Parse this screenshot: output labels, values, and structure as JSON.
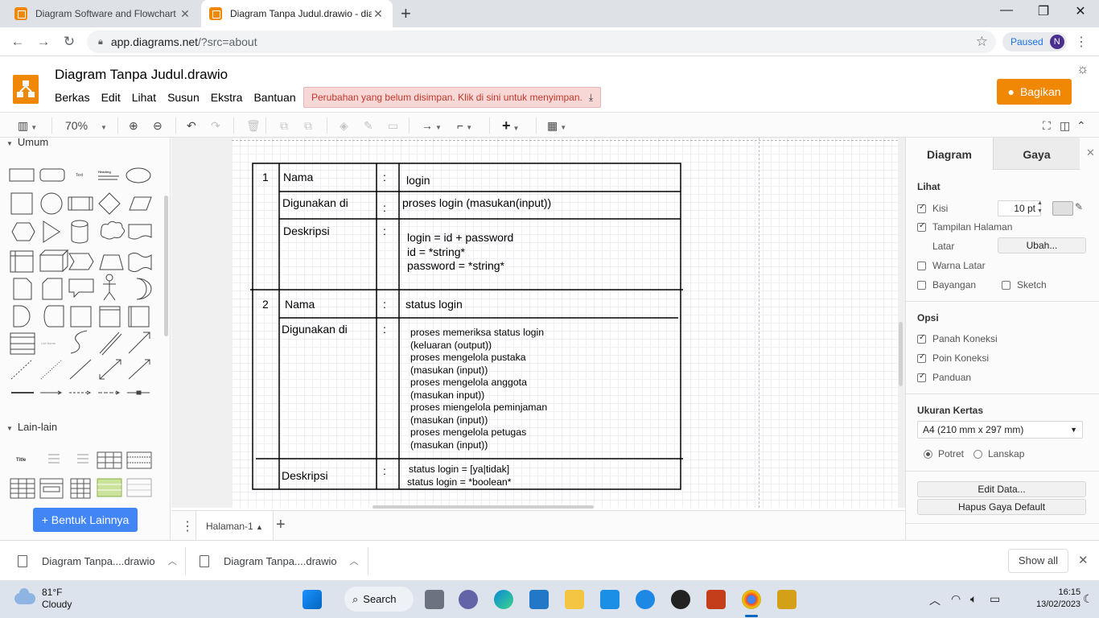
{
  "browser": {
    "tabs": [
      {
        "title": "Diagram Software and Flowchart",
        "active": false
      },
      {
        "title": "Diagram Tanpa Judul.drawio - dia",
        "active": true
      }
    ],
    "url_host": "app.diagrams.net",
    "url_rest": "/?src=about",
    "profile_status": "Paused",
    "profile_initial": "N"
  },
  "app": {
    "title": "Diagram Tanpa Judul.drawio",
    "menu": [
      "Berkas",
      "Edit",
      "Lihat",
      "Susun",
      "Ekstra",
      "Bantuan"
    ],
    "unsaved_notice": "Perubahan yang belum disimpan. Klik di sini untuk menyimpan.",
    "share_label": "Bagikan",
    "zoom": "70%"
  },
  "sidebar": {
    "section_general": "Umum",
    "section_misc": "Lain-lain",
    "more_shapes": "+ Bentuk Lainnya",
    "shape_text_labels": {
      "text": "Text",
      "heading": "Heading",
      "list_name": "List Name",
      "title": "Title"
    }
  },
  "diagram": {
    "row1": {
      "num": "1",
      "name_label": "Nama",
      "name_value": "login",
      "used_label": "Digunakan di",
      "used_value": "proses login (masukan(input))",
      "desc_label": "Deskripsi",
      "desc_lines": [
        "login = id + password",
        "id = *string*",
        "password = *string*"
      ]
    },
    "row2": {
      "num": "2",
      "name_label": "Nama",
      "name_value": "status login",
      "used_label": "Digunakan di",
      "used_lines": [
        "proses memeriksa status login",
        "(keluaran (output))",
        "proses mengelola pustaka",
        "(masukan (input))",
        "proses mengelola anggota",
        "(masukan input))",
        "proses miengelola peminjaman",
        "(masukan (input))",
        "proses mengelola petugas",
        "(masukan (input))"
      ],
      "desc_label": "Deskripsi",
      "desc_lines": [
        "status login = [ya|tidak]",
        "status login = *boolean*"
      ]
    },
    "colon": ":"
  },
  "page_tab": "Halaman-1",
  "format_panel": {
    "tab_diagram": "Diagram",
    "tab_style": "Gaya",
    "view_heading": "Lihat",
    "grid_label": "Kisi",
    "grid_checked": true,
    "grid_size": "10 pt",
    "page_view_label": "Tampilan Halaman",
    "page_view_checked": true,
    "background_label": "Latar",
    "change_button": "Ubah...",
    "bg_color_label": "Warna Latar",
    "shadow_label": "Bayangan",
    "sketch_label": "Sketch",
    "options_heading": "Opsi",
    "connection_arrows": "Panah Koneksi",
    "connection_points": "Poin Koneksi",
    "guides": "Panduan",
    "paper_heading": "Ukuran Kertas",
    "paper_size": "A4 (210 mm x 297 mm)",
    "portrait": "Potret",
    "landscape": "Lanskap",
    "edit_data": "Edit Data...",
    "clear_style": "Hapus Gaya Default"
  },
  "downloads": {
    "items": [
      "Diagram Tanpa....drawio",
      "Diagram Tanpa....drawio"
    ],
    "show_all": "Show all"
  },
  "taskbar": {
    "temp": "81°F",
    "weather": "Cloudy",
    "search": "Search",
    "time": "16:15",
    "date": "13/02/2023"
  },
  "colors": {
    "accent": "#f08705",
    "link_blue": "#1a73e8",
    "more_button": "#4285f4"
  }
}
